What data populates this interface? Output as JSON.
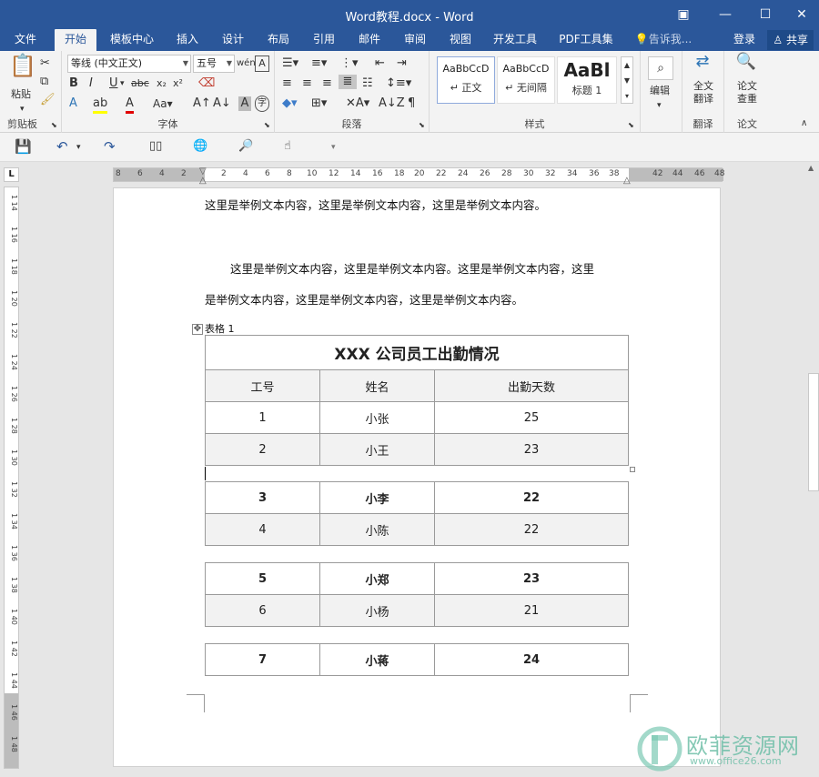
{
  "window": {
    "title": "Word教程.docx - Word"
  },
  "menu": {
    "tabs": [
      "文件",
      "开始",
      "模板中心",
      "插入",
      "设计",
      "布局",
      "引用",
      "邮件",
      "审阅",
      "视图",
      "开发工具",
      "PDF工具集"
    ],
    "active_tab": "开始",
    "tell_me": "告诉我...",
    "login": "登录",
    "share": "共享"
  },
  "ribbon": {
    "clipboard": {
      "paste": "粘贴",
      "label": "剪贴板"
    },
    "font": {
      "name": "等线 (中文正文)",
      "size": "五号",
      "label": "字体"
    },
    "paragraph": {
      "label": "段落"
    },
    "styles": {
      "label": "样式",
      "cards": [
        {
          "sample": "AaBbCcD",
          "name": "正文"
        },
        {
          "sample": "AaBbCcD",
          "name": "无间隔"
        },
        {
          "sample": "AaBl",
          "name": "标题 1"
        }
      ]
    },
    "editing": {
      "label": "编辑"
    },
    "translate": {
      "button": "全文翻译",
      "label": "翻译"
    },
    "thesis": {
      "button": "论文查重",
      "label": "论文"
    }
  },
  "ruler": {
    "top": [
      "8",
      "6",
      "4",
      "2",
      "2",
      "4",
      "6",
      "8",
      "10",
      "12",
      "14",
      "16",
      "18",
      "20",
      "22",
      "24",
      "26",
      "28",
      "30",
      "32",
      "34",
      "36",
      "38",
      "42",
      "44",
      "46",
      "48"
    ],
    "left": [
      "14",
      "16",
      "18",
      "20",
      "22",
      "24",
      "26",
      "28",
      "30",
      "32",
      "34",
      "36",
      "38",
      "40",
      "42",
      "44",
      "46",
      "48"
    ]
  },
  "document": {
    "para1": "这里是举例文本内容，这里是举例文本内容，这里是举例文本内容。",
    "para2_line1": "这里是举例文本内容，这里是举例文本内容。这里是举例文本内容，这里",
    "para2_line2": "是举例文本内容，这里是举例文本内容，这里是举例文本内容。",
    "table_caption": "表格 1",
    "table_title": "XXX 公司员工出勤情况",
    "headers": [
      "工号",
      "姓名",
      "出勤天数"
    ],
    "rows": [
      [
        "1",
        "小张",
        "25"
      ],
      [
        "2",
        "小王",
        "23"
      ],
      [
        "3",
        "小李",
        "22"
      ],
      [
        "4",
        "小陈",
        "22"
      ],
      [
        "5",
        "小郑",
        "23"
      ],
      [
        "6",
        "小杨",
        "21"
      ],
      [
        "7",
        "小蒋",
        "24"
      ]
    ]
  },
  "watermark": {
    "text": "欧菲资源网",
    "url": "www.office26.com"
  }
}
